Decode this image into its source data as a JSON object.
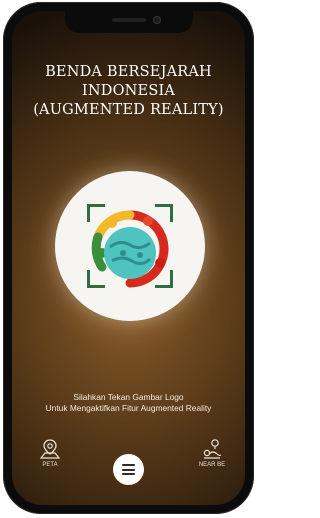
{
  "app": {
    "title_lines": [
      "BENDA BERSEJARAH",
      "INDONESIA",
      "(AUGMENTED REALITY)"
    ]
  },
  "scanner": {
    "icon": "scan-frame-icon",
    "logo_icon": "cultural-logo-icon",
    "frame_color": "#2f6d45"
  },
  "instruction": {
    "line1": "Silahkan Tekan Gambar Logo",
    "line2": "Untuk Mengaktifkan Fitur Augmented Reality"
  },
  "bottom_nav": {
    "left": {
      "label": "PETA",
      "icon": "map-pin-icon"
    },
    "center": {
      "icon": "hamburger-menu-icon"
    },
    "right": {
      "label": "NEAR BE",
      "icon": "nearby-location-icon"
    }
  },
  "colors": {
    "background_center": "#8a5c2a",
    "background_edge": "#0c0906",
    "accent_green": "#2f6d45"
  }
}
